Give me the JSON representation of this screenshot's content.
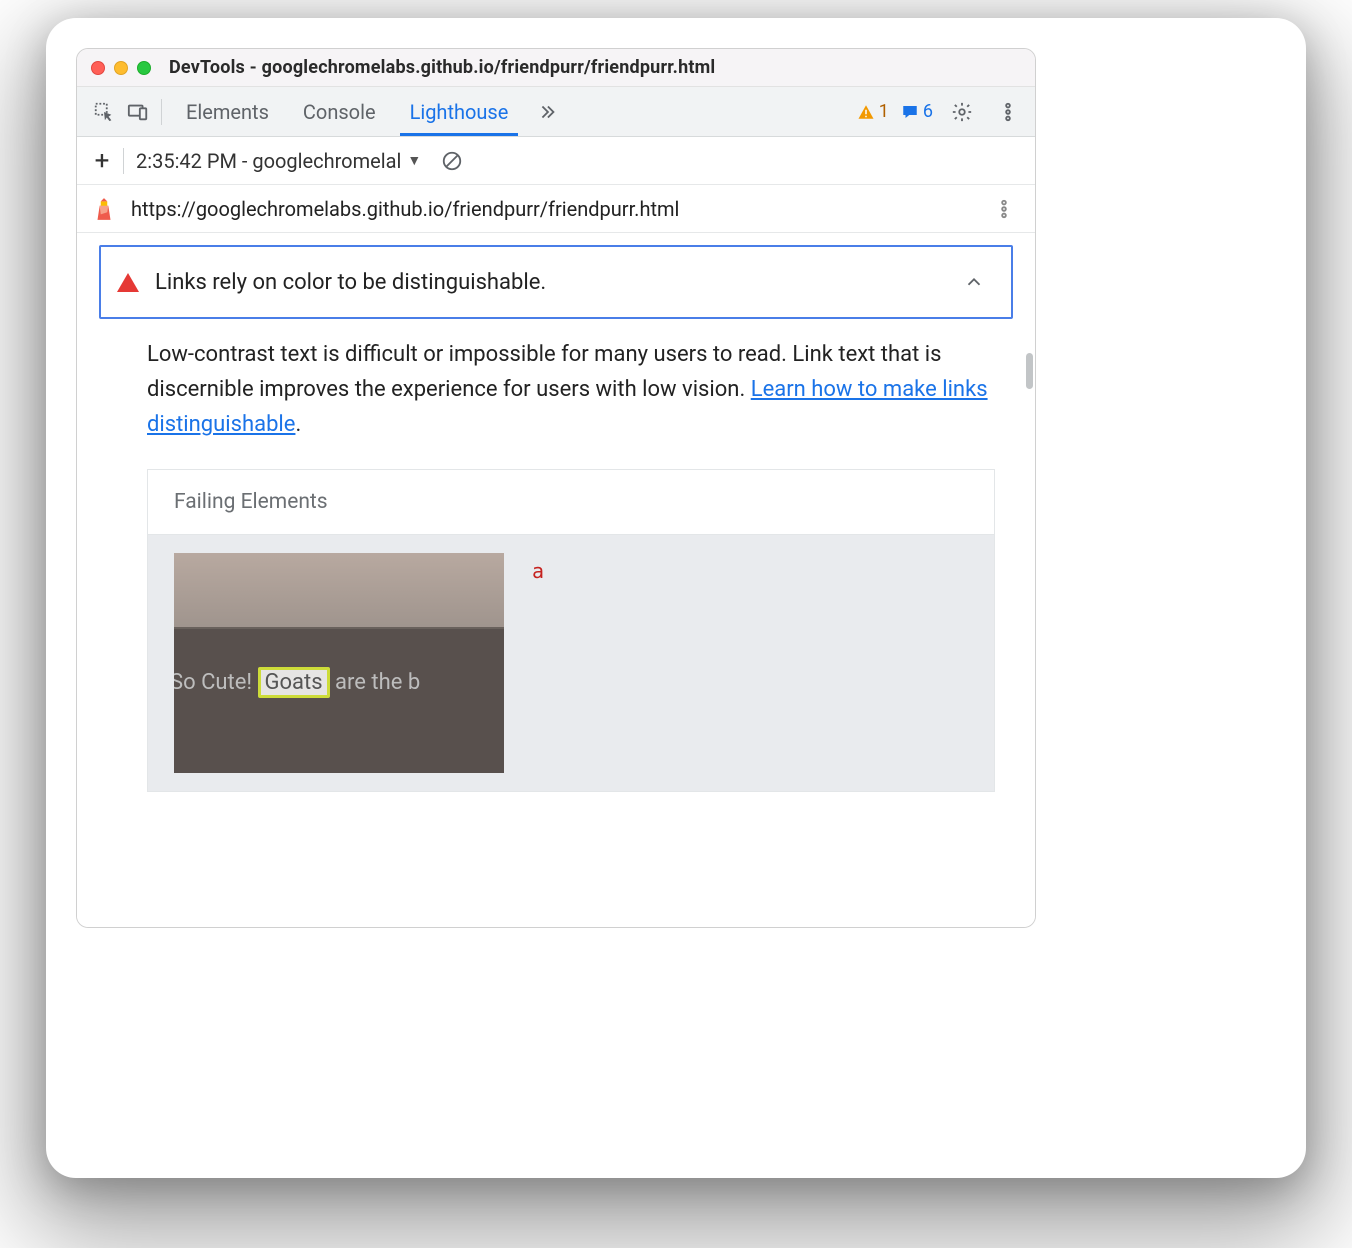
{
  "window": {
    "title": "DevTools - googlechromelabs.github.io/friendpurr/friendpurr.html"
  },
  "tabs": {
    "elements": "Elements",
    "console": "Console",
    "lighthouse": "Lighthouse"
  },
  "counts": {
    "warnings": "1",
    "messages": "6"
  },
  "reportbar": {
    "label": "2:35:42 PM - googlechromelal"
  },
  "urlbar": {
    "url": "https://googlechromelabs.github.io/friendpurr/friendpurr.html"
  },
  "audit": {
    "title": "Links rely on color to be distinguishable."
  },
  "desc": {
    "pre": "Low-contrast text is difficult or impossible for many users to read. Link text that is discernible improves the experience for users with low vision. ",
    "link": "Learn how to make links distinguishable",
    "post": "."
  },
  "failing": {
    "header": "Failing Elements",
    "snippet_pre": "So Cute! ",
    "snippet_hl": "Goats",
    "snippet_post": " are the b",
    "tag": "a"
  }
}
